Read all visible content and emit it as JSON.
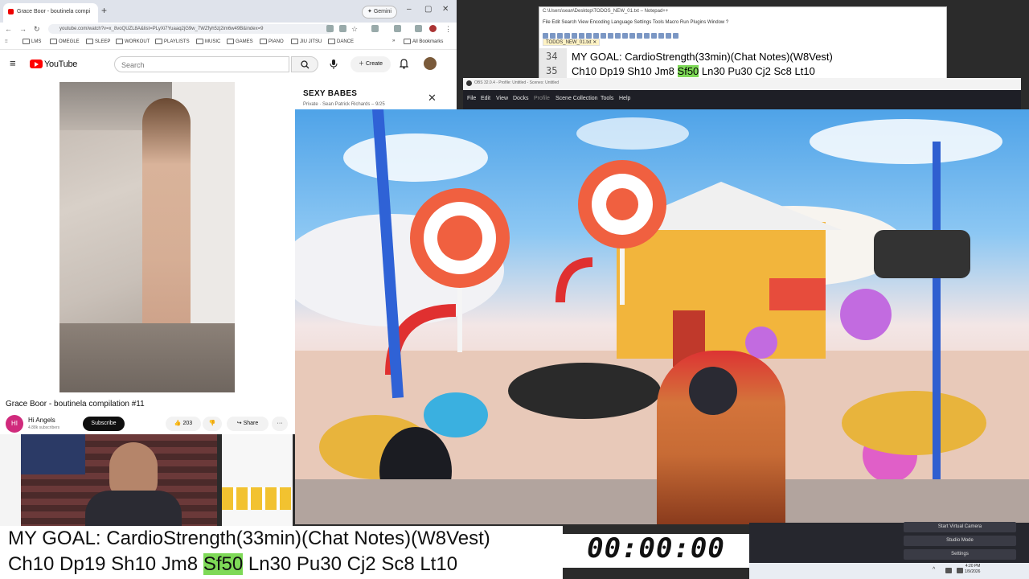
{
  "browser": {
    "tab_title": "Grace Boor - boutinela compi",
    "new_tab": "+",
    "gemini_label": "Gemini",
    "url": "youtube.com/watch?v=x_8voQUZL8A&list=PLyXi7Yuaaq2jG9w_7WZfyh5zj2im6w49B&index=9",
    "win_min": "–",
    "win_max": "▢",
    "win_close": "✕",
    "bookmarks": [
      "LMS",
      "OMEGLE",
      "SLEEP",
      "WORKOUT",
      "PLAYLISTS",
      "MUSIC",
      "GAMES",
      "PIANO",
      "JIU JITSU",
      "DANCE"
    ],
    "all_bookmarks": "All Bookmarks"
  },
  "youtube": {
    "logo_text": "YouTube",
    "search_placeholder": "Search",
    "create_label": "Create",
    "video_title": "Grace Boor - boutinela compilation #11",
    "channel_name": "Hi Angels",
    "channel_initials": "HI",
    "subscribers": "4.88k subscribers",
    "subscribe_label": "Subscribe",
    "likes": "203",
    "share_label": "Share",
    "more_label": "···",
    "playlist_title": "SEXY BABES",
    "playlist_sub": "Private · Sean Patrick Richards – 9/25",
    "playlist_close": "✕"
  },
  "notepad": {
    "title": "C:\\Users\\sean\\Desktop\\TODOS_NEW_01.txt – Notepad++",
    "menu": "File  Edit  Search  View  Encoding  Language  Settings  Tools  Macro  Run  Plugins  Window  ?",
    "tab": "TODOS_NEW_01.txt ✕",
    "lines": [
      {
        "num": "34",
        "pre": "MY GOAL: CardioStrength(33min)(Chat Notes)(W8Vest)",
        "hl": "",
        "post": ""
      },
      {
        "num": "35",
        "pre": "Ch10 Dp19 Sh10 Jm8 ",
        "hl": "Sf50",
        "post": " Ln30 Pu30 Cj2 Sc8 Lt10"
      }
    ]
  },
  "obs": {
    "title": "OBS 32.0.4 - Profile: Untitled - Scenes: Untitled",
    "menu": [
      "File",
      "Edit",
      "View",
      "Docks",
      "Profile",
      "Scene Collection",
      "Tools",
      "Help"
    ],
    "buttons": [
      "Start Virtual Camera",
      "Studio Mode",
      "Settings"
    ],
    "clock_time": "4:20 PM",
    "clock_date": "1/9/2026"
  },
  "overlay": {
    "goal_line": "MY GOAL: CardioStrength(33min)(Chat Notes)(W8Vest)",
    "ex_pre": "Ch10 Dp19 Sh10 Jm8 ",
    "ex_hl": "Sf50",
    "ex_post": " Ln30 Pu30 Cj2 Sc8 Lt10",
    "timer": "00:00:00"
  },
  "colors": {
    "youtube_red": "#ff0000",
    "highlight_green": "#7ed957",
    "obs_dark": "#1e1f26"
  }
}
